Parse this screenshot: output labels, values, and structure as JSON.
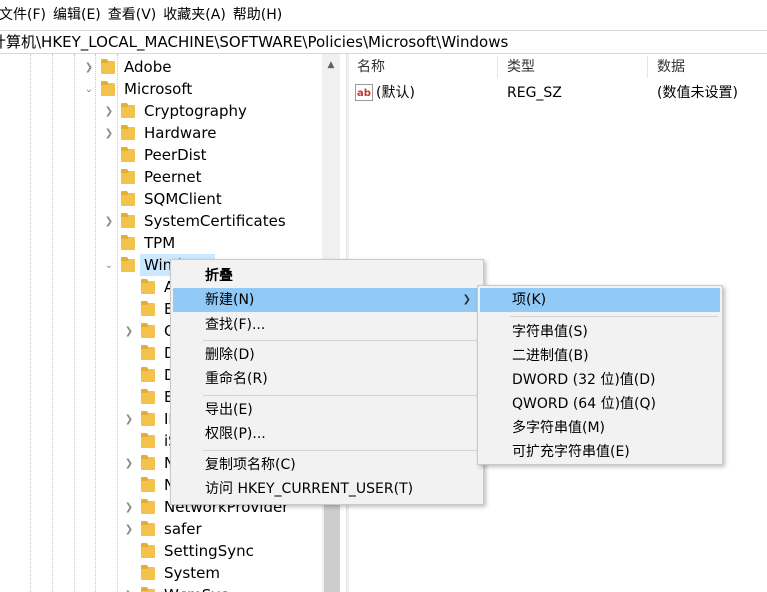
{
  "menubar": {
    "items": [
      "文件(F)",
      "编辑(E)",
      "查看(V)",
      "收藏夹(A)",
      "帮助(H)"
    ]
  },
  "address": "计算机\\HKEY_LOCAL_MACHINE\\SOFTWARE\\Policies\\Microsoft\\Windows",
  "tree": {
    "items": [
      {
        "label": "Adobe",
        "expander": "right"
      },
      {
        "label": "Microsoft",
        "expander": "down"
      },
      {
        "label": "Cryptography",
        "expander": "right"
      },
      {
        "label": "Hardware",
        "expander": "right"
      },
      {
        "label": "PeerDist",
        "expander": "none"
      },
      {
        "label": "Peernet",
        "expander": "none"
      },
      {
        "label": "SQMClient",
        "expander": "none"
      },
      {
        "label": "SystemCertificates",
        "expander": "right"
      },
      {
        "label": "TPM",
        "expander": "none"
      },
      {
        "label": "Windows",
        "expander": "down"
      },
      {
        "label": "A",
        "expander": "none"
      },
      {
        "label": "B",
        "expander": "none"
      },
      {
        "label": "C",
        "expander": "right"
      },
      {
        "label": "D",
        "expander": "none"
      },
      {
        "label": "D",
        "expander": "none"
      },
      {
        "label": "E",
        "expander": "none"
      },
      {
        "label": "II",
        "expander": "right"
      },
      {
        "label": "iS",
        "expander": "none"
      },
      {
        "label": "N",
        "expander": "right"
      },
      {
        "label": "N",
        "expander": "none"
      },
      {
        "label": "NetworkProvider",
        "expander": "right"
      },
      {
        "label": "safer",
        "expander": "right"
      },
      {
        "label": "SettingSync",
        "expander": "none"
      },
      {
        "label": "System",
        "expander": "none"
      },
      {
        "label": "WcmSvc",
        "expander": "right"
      }
    ]
  },
  "list": {
    "headers": [
      "名称",
      "类型",
      "数据"
    ],
    "rows": [
      {
        "name": "(默认)",
        "type": "REG_SZ",
        "data": "(数值未设置)",
        "icon": "ab-string-icon"
      }
    ]
  },
  "context_menu": {
    "items": [
      {
        "label": "折叠",
        "bold": true
      },
      {
        "label": "新建(N)",
        "submenu": true,
        "highlighted": true
      },
      {
        "label": "查找(F)..."
      },
      {
        "label": "删除(D)"
      },
      {
        "label": "重命名(R)"
      },
      {
        "label": "导出(E)"
      },
      {
        "label": "权限(P)..."
      },
      {
        "label": "复制项名称(C)"
      },
      {
        "label": "访问 HKEY_CURRENT_USER(T)"
      }
    ]
  },
  "submenu": {
    "items": [
      {
        "label": "项(K)",
        "highlighted": true
      },
      {
        "label": "字符串值(S)"
      },
      {
        "label": "二进制值(B)"
      },
      {
        "label": "DWORD (32 位)值(D)"
      },
      {
        "label": "QWORD (64 位)值(Q)"
      },
      {
        "label": "多字符串值(M)"
      },
      {
        "label": "可扩充字符串值(E)"
      }
    ]
  },
  "colors": {
    "highlight": "#91c9f7",
    "tree_selected": "#cce8ff",
    "folder": "#f2c24b"
  }
}
